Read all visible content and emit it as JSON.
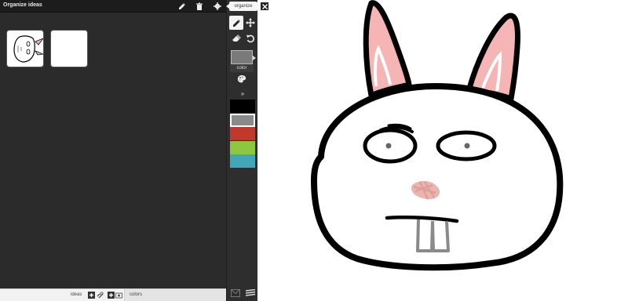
{
  "organizer": {
    "title": "Organize ideas",
    "header_icons": [
      "eraser-pencil-icon",
      "trash-icon",
      "gear-icon"
    ],
    "thumbnails": [
      {
        "name": "bunny-sketch-thumbnail"
      },
      {
        "name": "blank-idea-thumbnail"
      }
    ],
    "footer": {
      "ideas_label": "ideas",
      "colors_label": "colors"
    }
  },
  "toolbar": {
    "organize_label": "organize",
    "color_label": "color",
    "more_label": "»",
    "tools": [
      "pen-icon",
      "move-icon",
      "eraser-icon",
      "undo-icon"
    ],
    "current_color": "#7a7a7a",
    "swatches": [
      {
        "color": "#000000",
        "selected": false
      },
      {
        "color": "#8a8a8a",
        "selected": true
      },
      {
        "color": "#c0392b",
        "selected": false
      },
      {
        "color": "#8dc63f",
        "selected": false
      },
      {
        "color": "#3fa7b5",
        "selected": false
      }
    ]
  }
}
